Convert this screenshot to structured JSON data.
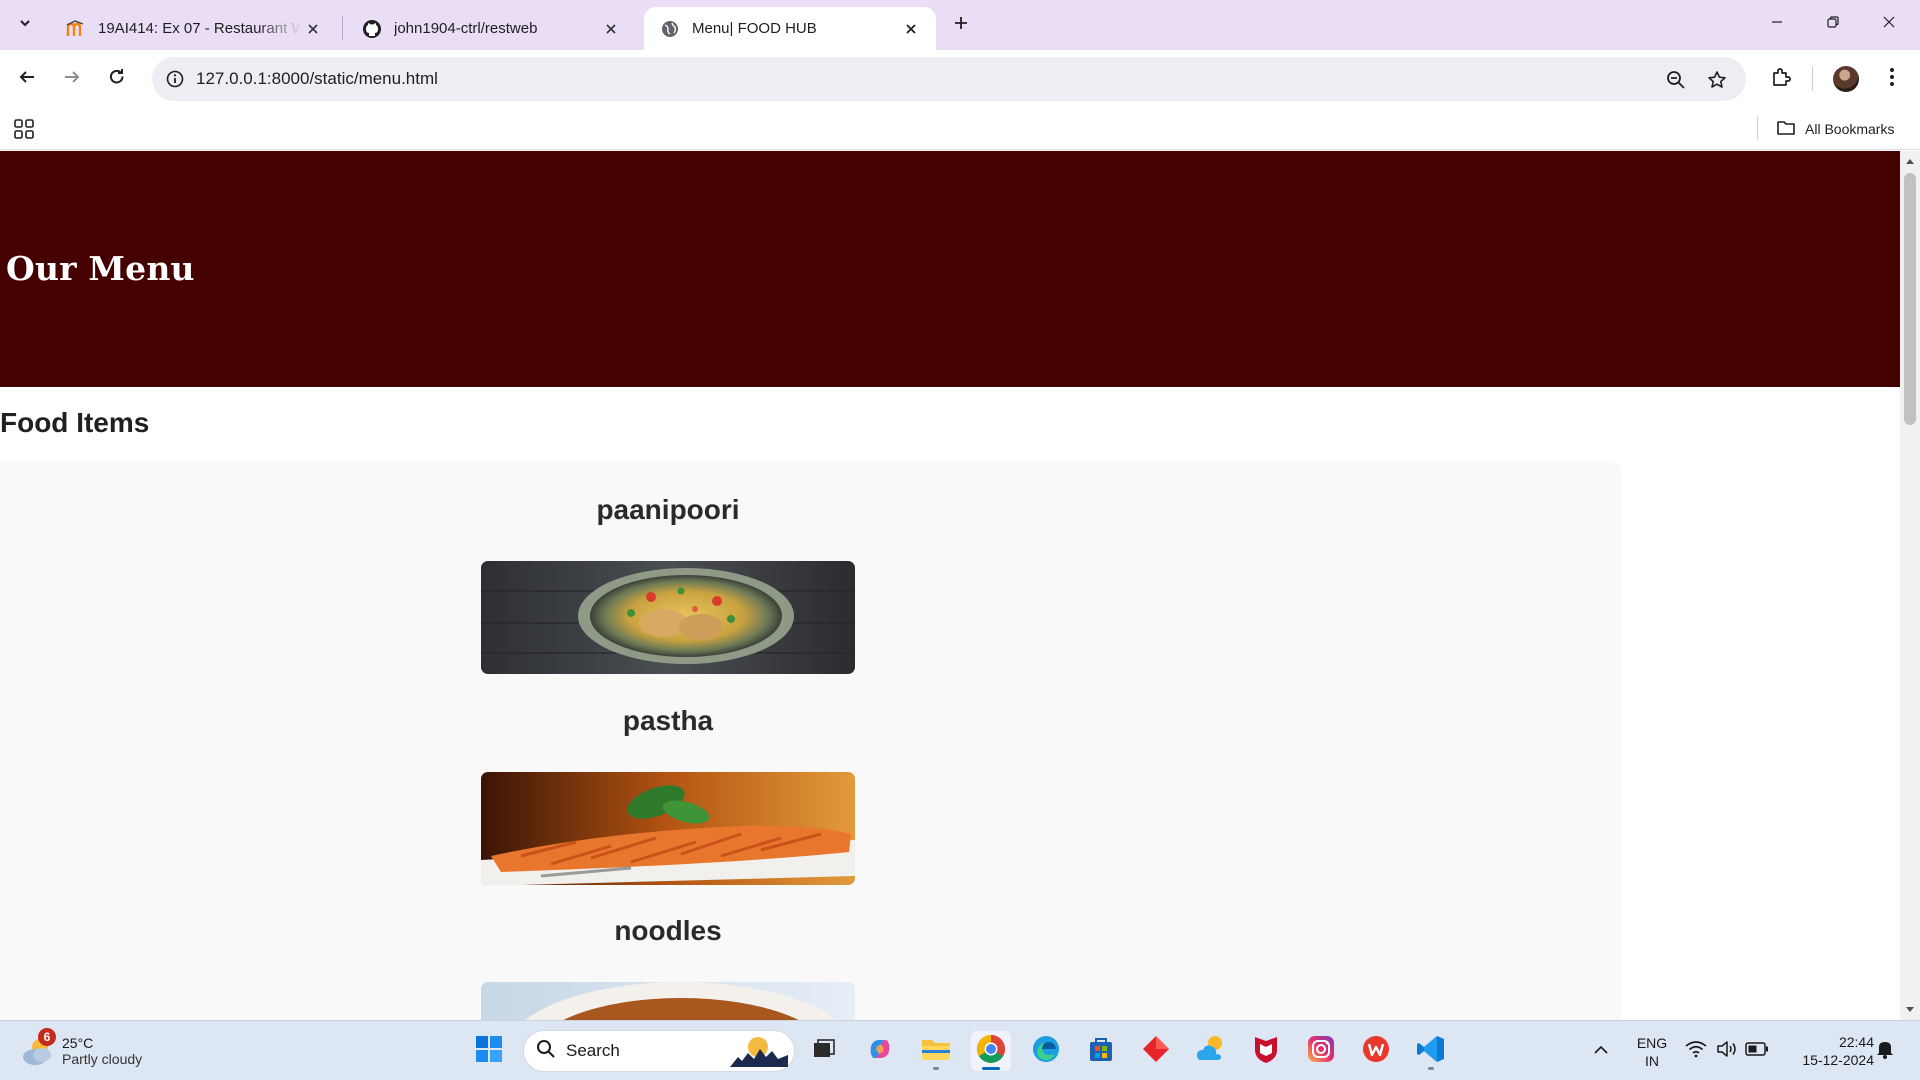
{
  "browser": {
    "tabs": [
      {
        "title": "19AI414: Ex 07 - Restaurant Web",
        "favicon": "moodle-icon",
        "active": false
      },
      {
        "title": "john1904-ctrl/restweb",
        "favicon": "github-icon",
        "active": false
      },
      {
        "title": "Menu| FOOD HUB",
        "favicon": "globe-icon",
        "active": true
      }
    ],
    "address_bar": {
      "url": "127.0.0.1:8000/static/menu.html"
    },
    "bookmarks_bar": {
      "all_bookmarks_label": "All Bookmarks"
    }
  },
  "page": {
    "header_title": "Our Menu",
    "header_color": "#450000",
    "section_title": "Food Items",
    "items": [
      {
        "name": "paanipoori"
      },
      {
        "name": "pastha"
      },
      {
        "name": "noodles"
      }
    ]
  },
  "taskbar": {
    "weather": {
      "temp": "25°C",
      "desc": "Partly cloudy",
      "badge": "6"
    },
    "search_label": "Search",
    "language": {
      "line1": "ENG",
      "line2": "IN"
    },
    "clock": {
      "time": "22:44",
      "date": "15-12-2024"
    }
  }
}
